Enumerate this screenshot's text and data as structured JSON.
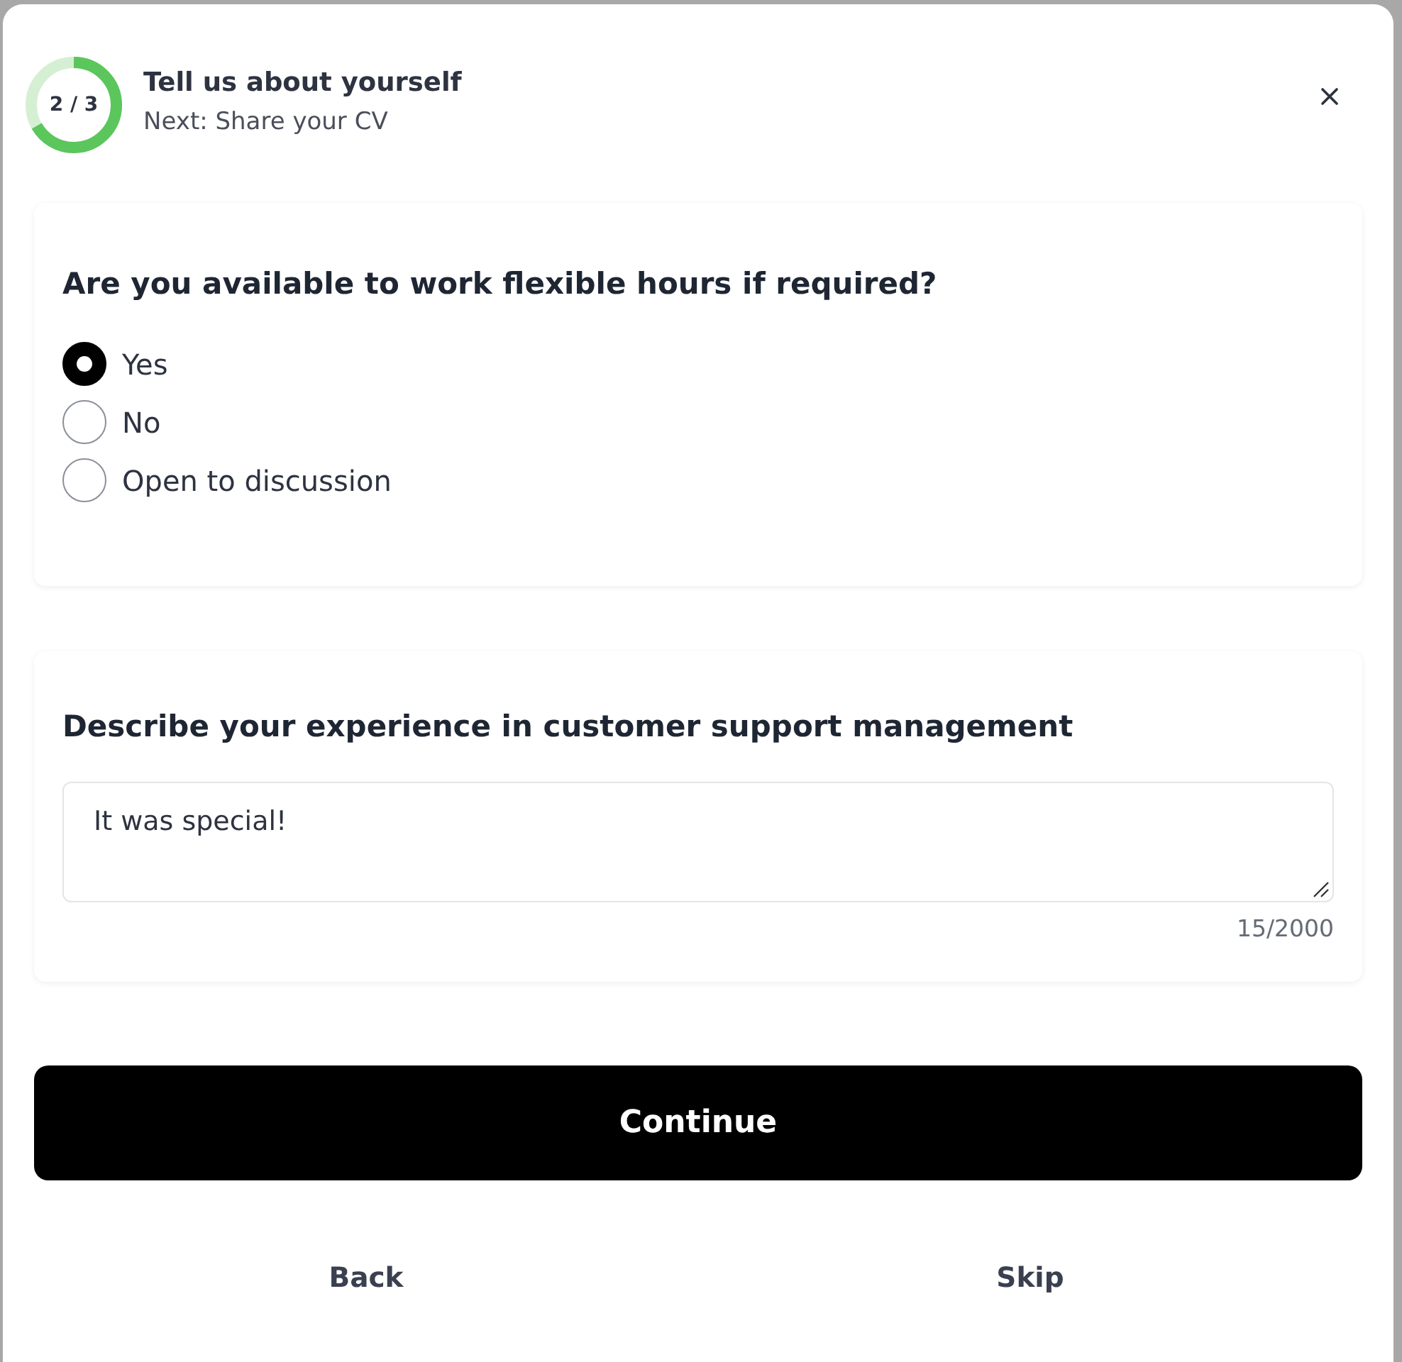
{
  "header": {
    "progress": {
      "label": "2 / 3",
      "level": 0.667
    },
    "title": "Tell us about yourself",
    "subtitle": "Next: Share your CV"
  },
  "questions": [
    {
      "kind": "radio",
      "question": "Are you available to work flexible hours if required?",
      "options": [
        {
          "label": "Yes",
          "selected": true
        },
        {
          "label": "No",
          "selected": false
        },
        {
          "label": "Open to discussion",
          "selected": false
        }
      ]
    },
    {
      "kind": "textarea",
      "question": "Describe your experience in customer support management",
      "value": "It was special!",
      "counter": "15/2000"
    }
  ],
  "actions": {
    "primary": "Continue",
    "secondary": [
      "Back",
      "Skip"
    ]
  }
}
